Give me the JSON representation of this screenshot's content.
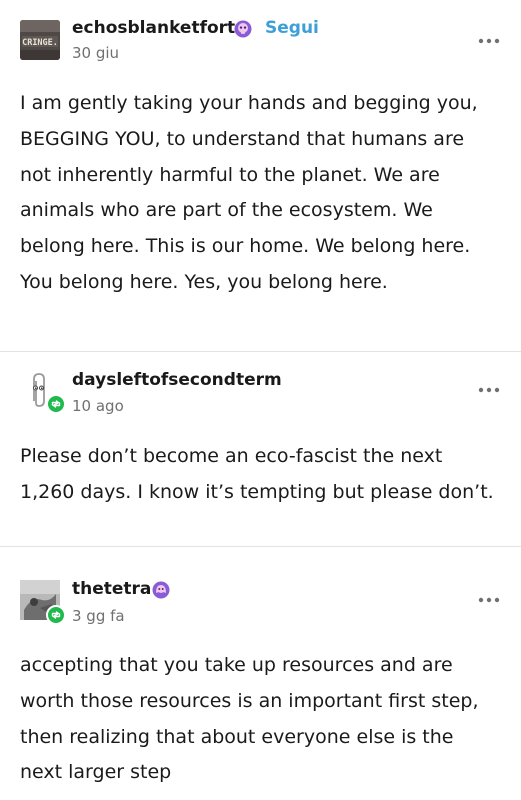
{
  "posts": [
    {
      "username": "echosblanketfort",
      "follow_label": "Segui",
      "timestamp": "30 giu",
      "avatar_text": "CRINGE.",
      "body": "I am gently taking your hands and begging you, BEGGING YOU, to understand that humans are not inherently harmful to the planet. We are animals who are part of the ecosystem. We belong here. This is our home. We belong here. You belong here. Yes, you belong here."
    },
    {
      "username": "daysleftofsecondterm",
      "timestamp": "10 ago",
      "body": "Please don’t become an eco-fascist the next 1,260 days. I know it’s tempting but please don’t."
    },
    {
      "username": "thetetra",
      "timestamp": "3 gg fa",
      "body": "accepting that you take up resources and are worth those resources is an important first step, then realizing that about everyone else is the next larger step"
    }
  ],
  "colors": {
    "follow": "#3d9fd9",
    "reblog_badge": "#1fb94d",
    "badge_purple": "#8a5bd6",
    "timestamp": "#707070"
  },
  "icons": {
    "more": "more-options-icon",
    "reblog": "reblog-icon",
    "skull_badge": "skull-badge-icon",
    "blob_badge": "blob-badge-icon"
  }
}
